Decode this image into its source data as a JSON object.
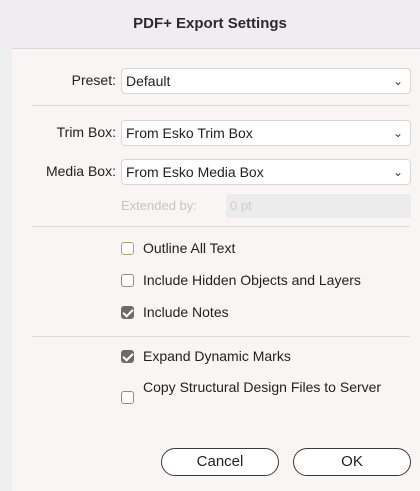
{
  "window": {
    "title": "PDF+ Export Settings"
  },
  "preset": {
    "label": "Preset:",
    "value": "Default"
  },
  "trim_box": {
    "label": "Trim Box:",
    "value": "From Esko Trim Box"
  },
  "media_box": {
    "label": "Media Box:",
    "value": "From Esko Media Box"
  },
  "extended_by": {
    "label": "Extended by:",
    "value": "0 pt"
  },
  "options": {
    "outline_all_text": {
      "label": "Outline All Text",
      "checked": false
    },
    "include_hidden": {
      "label": "Include Hidden Objects and Layers",
      "checked": false
    },
    "include_notes": {
      "label": "Include Notes",
      "checked": true
    },
    "expand_dynamic_marks": {
      "label": "Expand Dynamic Marks",
      "checked": true
    },
    "copy_structural": {
      "label": "Copy Structural Design Files to Server",
      "checked": false
    }
  },
  "buttons": {
    "cancel": "Cancel",
    "ok": "OK"
  },
  "icons": {
    "dropdown": "chevron-down-icon",
    "check": "checkmark-icon"
  }
}
